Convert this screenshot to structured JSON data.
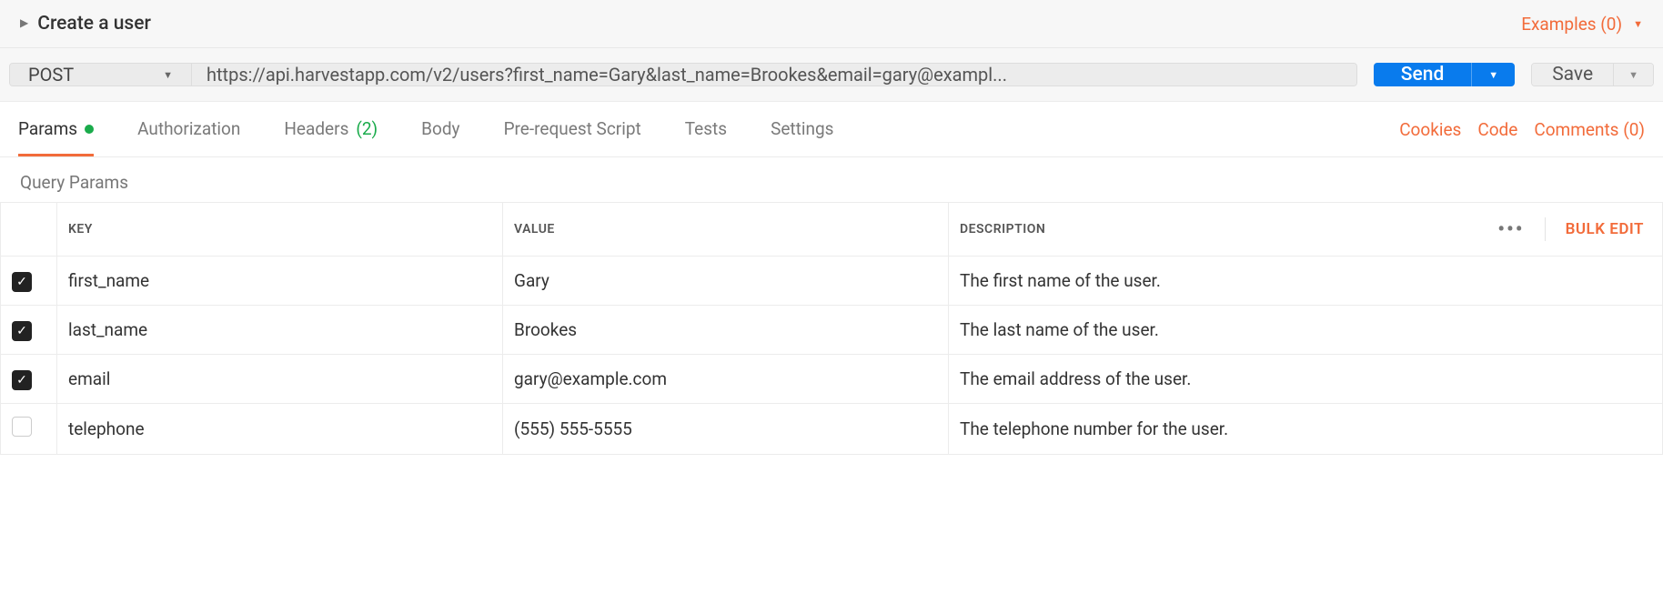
{
  "header": {
    "title": "Create a user",
    "examples_label": "Examples (0)"
  },
  "request": {
    "method": "POST",
    "url": "https://api.harvestapp.com/v2/users?first_name=Gary&last_name=Brookes&email=gary@exampl...",
    "send_label": "Send",
    "save_label": "Save"
  },
  "tabs": {
    "items": [
      {
        "label": "Params",
        "active": true,
        "indicator": "dot"
      },
      {
        "label": "Authorization"
      },
      {
        "label": "Headers",
        "count": "(2)"
      },
      {
        "label": "Body"
      },
      {
        "label": "Pre-request Script"
      },
      {
        "label": "Tests"
      },
      {
        "label": "Settings"
      }
    ],
    "right_links": {
      "cookies": "Cookies",
      "code": "Code",
      "comments": "Comments (0)"
    }
  },
  "params_section": {
    "heading": "Query Params",
    "columns": {
      "key": "KEY",
      "value": "VALUE",
      "description": "DESCRIPTION"
    },
    "bulk_edit": "Bulk Edit",
    "rows": [
      {
        "checked": true,
        "key": "first_name",
        "value": "Gary",
        "description": "The first name of the user."
      },
      {
        "checked": true,
        "key": "last_name",
        "value": "Brookes",
        "description": "The last name of the user."
      },
      {
        "checked": true,
        "key": "email",
        "value": "gary@example.com",
        "description": "The email address of the user."
      },
      {
        "checked": false,
        "key": "telephone",
        "value": "(555) 555-5555",
        "description": "The telephone number for the user."
      }
    ]
  }
}
